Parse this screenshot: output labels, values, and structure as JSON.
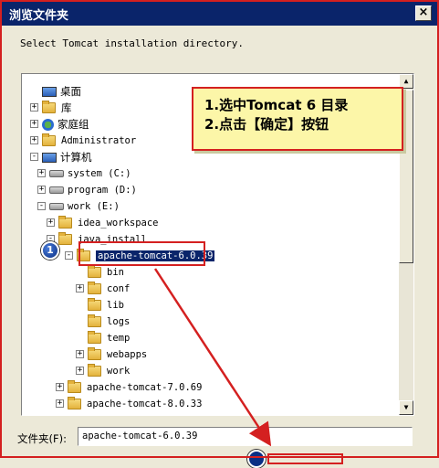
{
  "window": {
    "title": "浏览文件夹",
    "close_label": "×"
  },
  "instruction": "Select Tomcat installation directory.",
  "tree": [
    {
      "label": "桌面",
      "icon": "desktop-icon",
      "cn": true
    },
    {
      "label": "库",
      "icon": "library-folder-icon",
      "cn": true,
      "exp": "+"
    },
    {
      "label": "家庭组",
      "icon": "homegroup-icon",
      "cn": true,
      "exp": "+"
    },
    {
      "label": "Administrator",
      "icon": "user-folder-icon",
      "exp": "+"
    },
    {
      "label": "计算机",
      "icon": "computer-icon",
      "cn": true,
      "exp": "−"
    },
    {
      "label": "system (C:)",
      "icon": "drive-c-icon",
      "exp": "+"
    },
    {
      "label": "program (D:)",
      "icon": "drive-icon",
      "exp": "+"
    },
    {
      "label": "work (E:)",
      "icon": "drive-icon",
      "exp": "−"
    },
    {
      "label": "idea_workspace",
      "icon": "folder-icon",
      "exp": "+"
    },
    {
      "label": "java_install",
      "icon": "folder-icon",
      "exp": "−"
    },
    {
      "label": "apache-tomcat-6.0.39",
      "icon": "folder-icon",
      "exp": "−",
      "selected": true
    },
    {
      "label": "bin",
      "icon": "folder-icon"
    },
    {
      "label": "conf",
      "icon": "folder-icon",
      "exp": "+"
    },
    {
      "label": "lib",
      "icon": "folder-icon"
    },
    {
      "label": "logs",
      "icon": "folder-icon"
    },
    {
      "label": "temp",
      "icon": "folder-icon"
    },
    {
      "label": "webapps",
      "icon": "folder-icon",
      "exp": "+"
    },
    {
      "label": "work",
      "icon": "folder-icon",
      "exp": "+"
    },
    {
      "label": "apache-tomcat-7.0.69",
      "icon": "folder-icon",
      "exp": "+"
    },
    {
      "label": "apache-tomcat-8.0.33",
      "icon": "folder-icon",
      "exp": "+"
    }
  ],
  "callout": {
    "line1": "1.选中Tomcat 6 目录",
    "line2": "2.点击【确定】按钮"
  },
  "badge_number": "1",
  "folder_field": {
    "label": "文件夹(F):",
    "value": "apache-tomcat-6.0.39"
  },
  "colors": {
    "accent_red": "#d42020",
    "selection": "#0a246a",
    "callout_bg": "#fcf6a8"
  }
}
